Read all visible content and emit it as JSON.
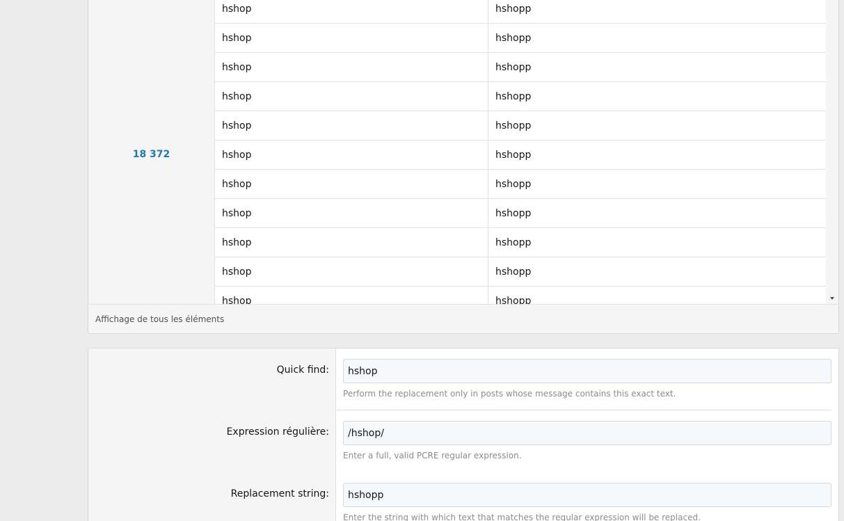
{
  "results": {
    "post_count": "18 372",
    "rows": [
      {
        "find": "hshop",
        "replace": "hshopp"
      },
      {
        "find": "hshop",
        "replace": "hshopp"
      },
      {
        "find": "hshop",
        "replace": "hshopp"
      },
      {
        "find": "hshop",
        "replace": "hshopp"
      },
      {
        "find": "hshop",
        "replace": "hshopp"
      },
      {
        "find": "hshop",
        "replace": "hshopp"
      },
      {
        "find": "hshop",
        "replace": "hshopp"
      },
      {
        "find": "hshop",
        "replace": "hshopp"
      },
      {
        "find": "hshop",
        "replace": "hshopp"
      },
      {
        "find": "hshop",
        "replace": "hshopp"
      },
      {
        "find": "hshop",
        "replace": "hshopp"
      }
    ],
    "footer_text": "Affichage de tous les éléments"
  },
  "form": {
    "quick_find": {
      "label": "Quick find:",
      "value": "hshop",
      "hint": "Perform the replacement only in posts whose message contains this exact text."
    },
    "regex": {
      "label": "Expression régulière:",
      "value": "/hshop/",
      "hint": "Enter a full, valid PCRE regular expression."
    },
    "replacement": {
      "label": "Replacement string:",
      "value": "hshopp",
      "hint": "Enter the string with which text that matches the regular expression will be replaced."
    }
  },
  "colors": {
    "page_bg": "#ececec",
    "link": "#2577b1",
    "input_bg": "#f5f9fc",
    "hint": "#8c8c8c"
  }
}
